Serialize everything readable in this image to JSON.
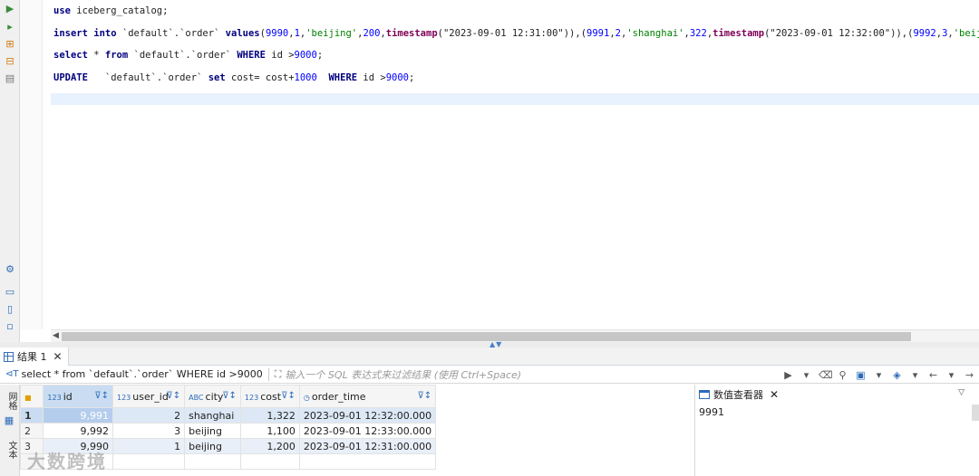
{
  "editor": {
    "lines": [
      "use iceberg_catalog;",
      "insert into `default`.`order` values(9990,1,'beijing',200,timestamp(\"2023-09-01 12:31:00\")),(9991,2,'shanghai',322,timestamp(\"2023-09-01 12:32:00\")),(9992,3,'beijing',100,timest",
      "select * from `default`.`order` WHERE id >9000;",
      "UPDATE   `default`.`order` set cost= cost+1000  WHERE id >9000;"
    ]
  },
  "results": {
    "tab_label": "结果 1",
    "query_text": "select * from `default`.`order` WHERE id >9000",
    "filter_placeholder": "输入一个 SQL 表达式来过滤结果 (使用 Ctrl+Space)",
    "side_labels": [
      "网格",
      "文本"
    ],
    "columns": [
      {
        "type": "123",
        "name": "id"
      },
      {
        "type": "123",
        "name": "user_id"
      },
      {
        "type": "ABC",
        "name": "city"
      },
      {
        "type": "123",
        "name": "cost"
      },
      {
        "type": "◷",
        "name": "order_time"
      }
    ],
    "rows": [
      {
        "n": "1",
        "cells": [
          "9,991",
          "2",
          "shanghai",
          "1,322",
          "2023-09-01 12:32:00.000"
        ]
      },
      {
        "n": "2",
        "cells": [
          "9,992",
          "3",
          "beijing",
          "1,100",
          "2023-09-01 12:33:00.000"
        ]
      },
      {
        "n": "3",
        "cells": [
          "9,990",
          "1",
          "beijing",
          "1,200",
          "2023-09-01 12:31:00.000"
        ]
      }
    ]
  },
  "viewer": {
    "title": "数值查看器",
    "value": "9991"
  },
  "watermark": "大数跨境",
  "colors": {
    "accent": "#2c6bb7",
    "selection": "#c9dcf2",
    "keyword": "#7f0055",
    "string": "#008000"
  }
}
